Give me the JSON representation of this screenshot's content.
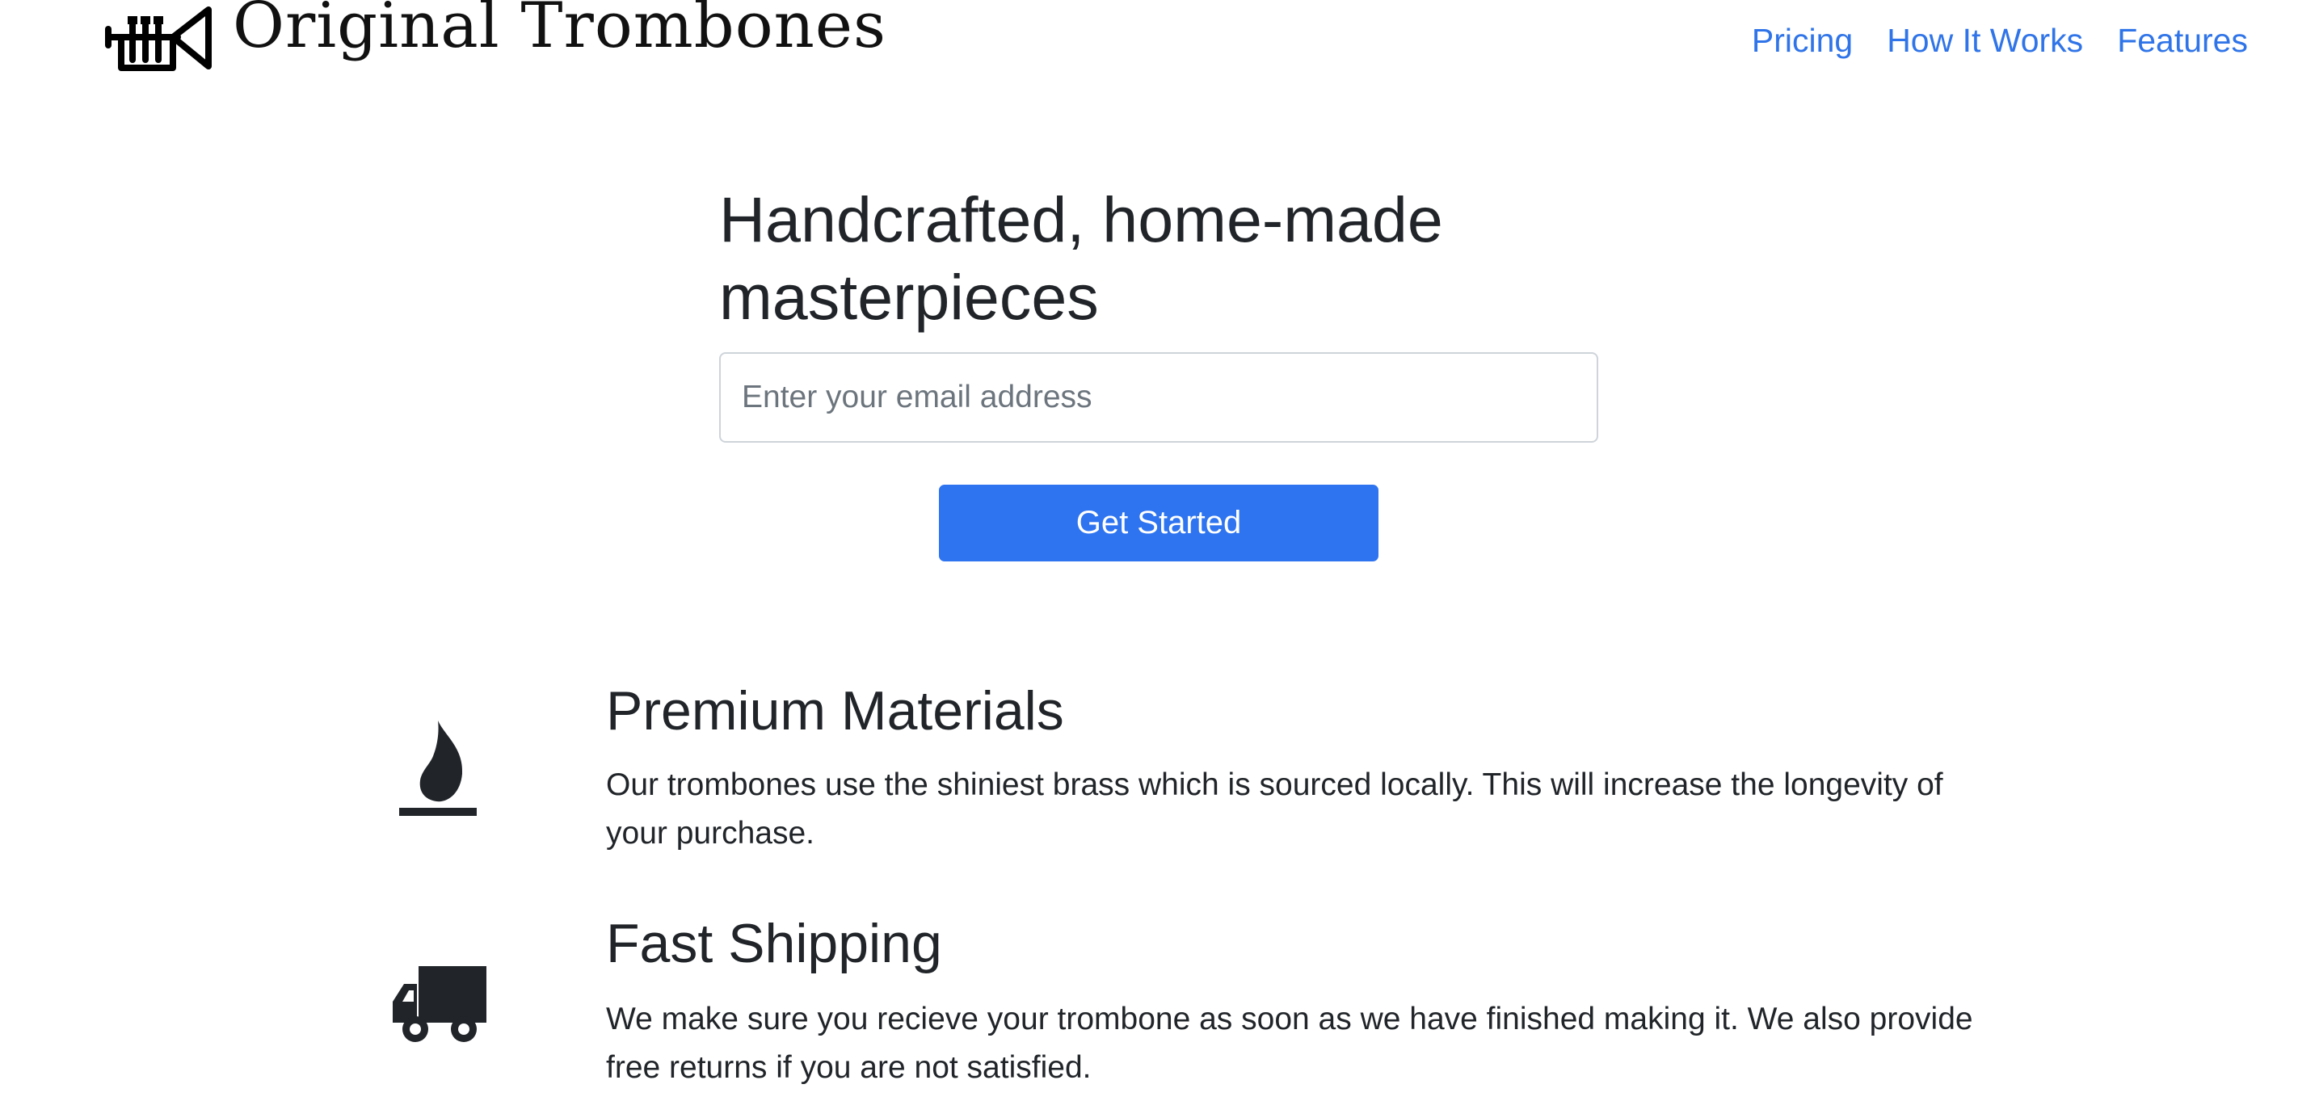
{
  "header": {
    "brand": "Original Trombones",
    "logo_icon": "trumpet-icon",
    "nav": [
      "Pricing",
      "How It Works",
      "Features"
    ]
  },
  "hero": {
    "title": "Handcrafted, home-made masterpieces",
    "email_placeholder": "Enter your email address",
    "cta_label": "Get Started"
  },
  "features": [
    {
      "icon": "fire-icon",
      "title": "Premium Materials",
      "description": "Our trombones use the shiniest brass which is sourced locally. This will increase the longevity of your purchase."
    },
    {
      "icon": "truck-icon",
      "title": "Fast Shipping",
      "description": "We make sure you recieve your trombone as soon as we have finished making it. We also provide free returns if you are not satisfied."
    }
  ],
  "colors": {
    "link": "#2f74e8",
    "primary_button": "#2e74f0",
    "text": "#212529",
    "input_border": "#ced4da"
  }
}
